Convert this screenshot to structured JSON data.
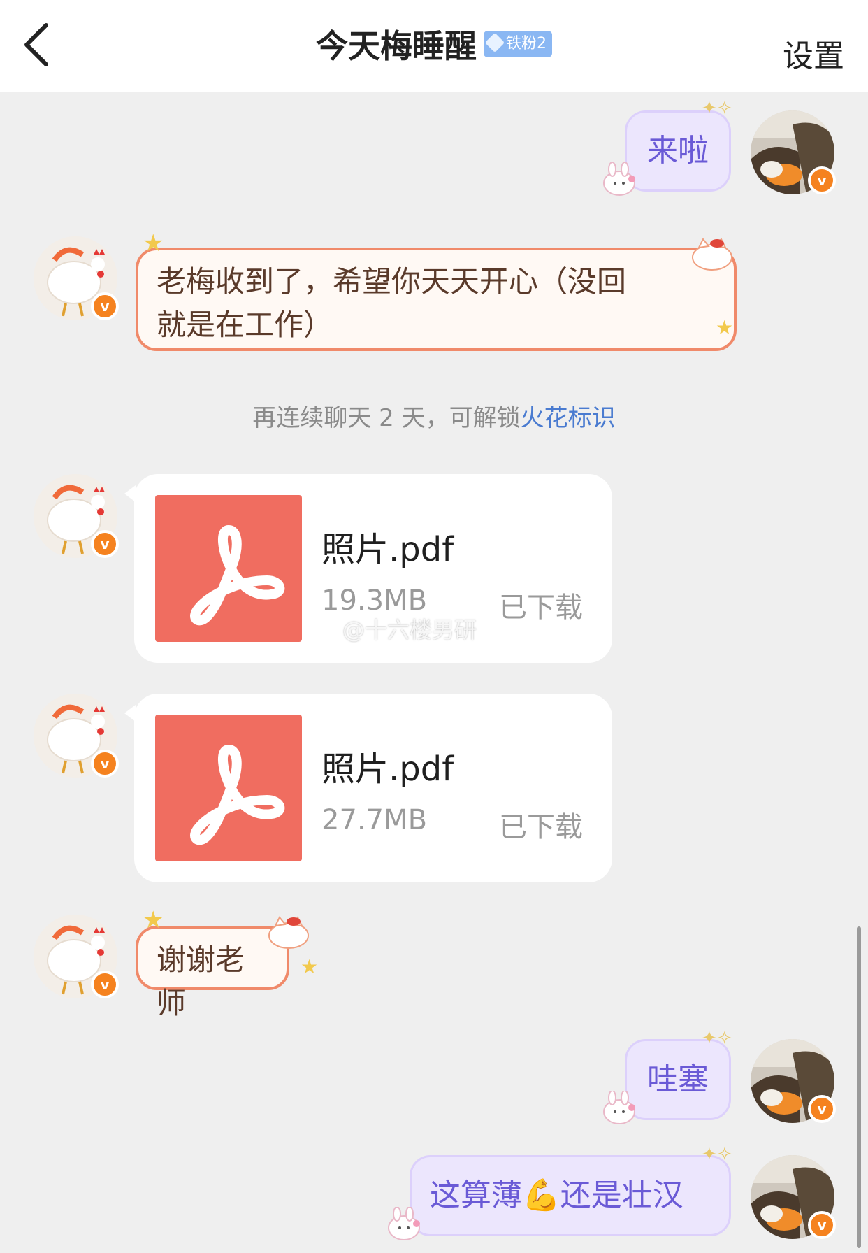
{
  "header": {
    "title": "今天梅睡醒",
    "fan_badge": "铁粉2",
    "settings_label": "设置"
  },
  "messages": {
    "m1": {
      "text": "来啦"
    },
    "m2": {
      "line1": "老梅收到了，希望你天天开心（没回",
      "line2": "就是在工作）"
    },
    "system": {
      "prefix": "再连续聊天 2 天，可解锁",
      "link": "火花标识"
    },
    "file1": {
      "name": "照片.pdf",
      "size": "19.3MB",
      "status": "已下载"
    },
    "file2": {
      "name": "照片.pdf",
      "size": "27.7MB",
      "status": "已下载"
    },
    "m3": {
      "text": "谢谢老师"
    },
    "m4": {
      "text": "哇塞"
    },
    "m5": {
      "before": "这算薄",
      "emoji": "💪",
      "after": "还是壮汉"
    }
  },
  "watermark": "@十六楼男研",
  "verify_badge": "v",
  "colors": {
    "outgoing_bubble": "#ece6fd",
    "outgoing_text": "#6a5ad6",
    "incoming_border": "#f08a6a",
    "pdf_icon": "#f06d60",
    "verified_badge": "#f5821f",
    "link": "#4a7bd0"
  },
  "icons": {
    "back": "chevron-left-icon",
    "pdf": "adobe-pdf-icon",
    "verified": "verified-v-icon"
  }
}
